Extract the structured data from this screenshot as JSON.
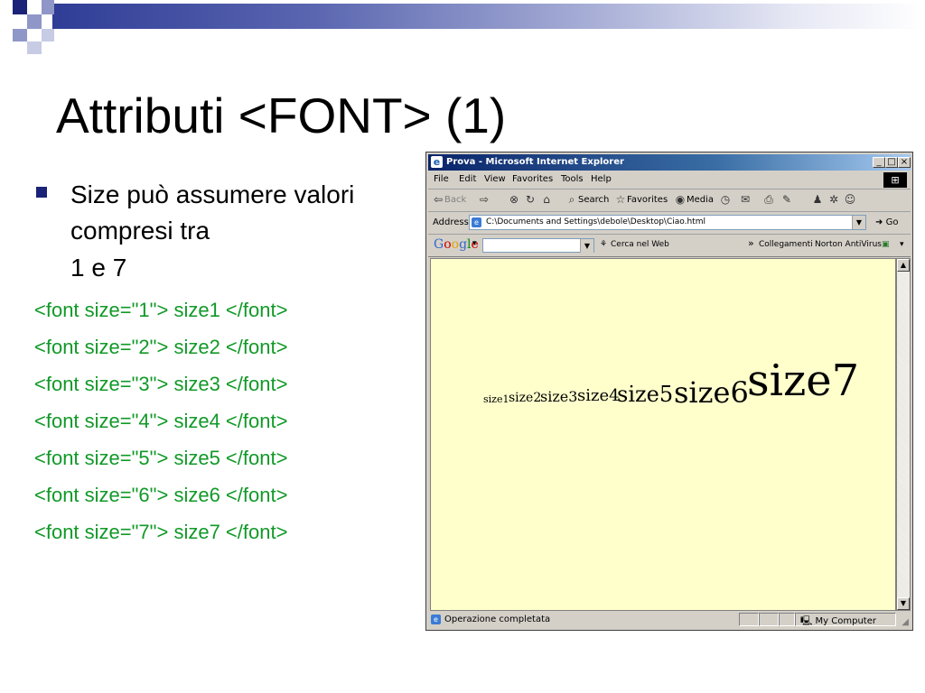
{
  "slide": {
    "title": "Attributi <FONT> (1)",
    "bullet_line1": "Size può assumere valori",
    "bullet_line2": "compresi tra",
    "range": "1 e 7",
    "code_lines": [
      "<font size=\"1\"> size1 </font>",
      "<font size=\"2\"> size2 </font>",
      "<font size=\"3\"> size3 </font>",
      "<font size=\"4\"> size4 </font>",
      "<font size=\"5\"> size5 </font>",
      "<font size=\"6\"> size6 </font>",
      "<font size=\"7\"> size7 </font>"
    ],
    "colors": {
      "accent_bar": "#2f3d96",
      "code_text": "#119928",
      "bullet_marker": "#1a2378"
    }
  },
  "browser": {
    "title": "Prova - Microsoft Internet Explorer",
    "window_buttons": [
      "_",
      "□",
      "×"
    ],
    "menu": [
      "File",
      "Edit",
      "View",
      "Favorites",
      "Tools",
      "Help"
    ],
    "toolbar": {
      "back": "Back",
      "search": "Search",
      "favorites": "Favorites",
      "media": "Media"
    },
    "address_label": "Address",
    "address_value": "C:\\Documents and Settings\\debole\\Desktop\\Ciao.html",
    "go_label": "Go",
    "google": {
      "logo": "Google",
      "search_value": "",
      "cerca_label": "Cerca nel Web",
      "collegamenti": "Collegamenti",
      "norton": "Norton AntiVirus"
    },
    "page_text": [
      "size1",
      "size2",
      "size3",
      "size4",
      "size5",
      "size6",
      "size7"
    ],
    "page_background": "#ffffcc",
    "status_text": "Operazione completata",
    "zone": "My Computer"
  }
}
